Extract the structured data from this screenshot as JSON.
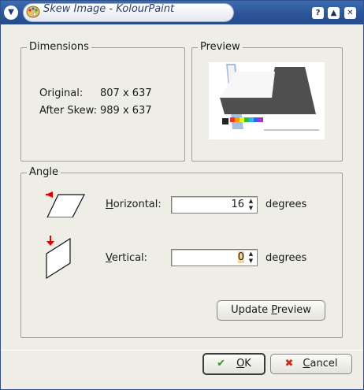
{
  "window": {
    "title": "Skew Image - KolourPaint"
  },
  "titlebar": {
    "menu_icon": "chevron-down-icon",
    "help_label": "?",
    "shade_label": "▲",
    "close_label": "✕"
  },
  "dimensions": {
    "title": "Dimensions",
    "original_label": "Original:",
    "original_value": "807 x 637",
    "after_label": "After Skew:",
    "after_value": "989 x 637"
  },
  "preview": {
    "title": "Preview"
  },
  "angle": {
    "title": "Angle",
    "horizontal_label_key": "H",
    "horizontal_label_rest": "orizontal:",
    "horizontal_value": "16",
    "vertical_label_key": "V",
    "vertical_label_rest": "ertical:",
    "vertical_value": "0",
    "unit": "degrees",
    "update_prefix": "Update ",
    "update_key": "P",
    "update_rest": "review"
  },
  "footer": {
    "ok_key": "O",
    "ok_rest": "K",
    "cancel_key": "C",
    "cancel_rest": "ancel"
  },
  "colors": {
    "accent": "#2c5599",
    "arrow_red": "#e00000"
  }
}
